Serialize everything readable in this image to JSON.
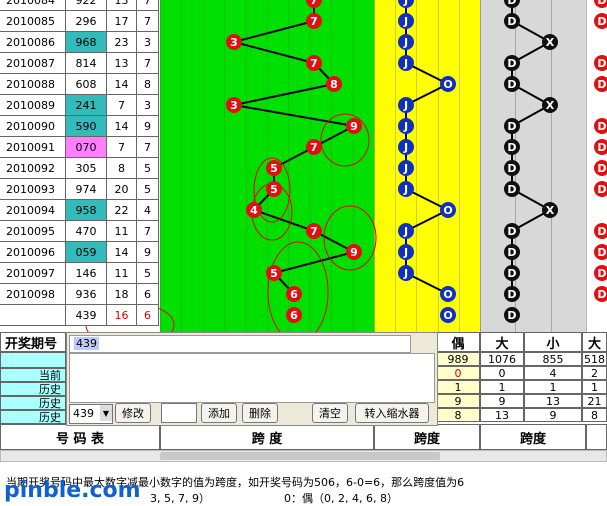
{
  "rows": [
    {
      "period": "2010084",
      "number": "922",
      "sum": "13",
      "span": "7",
      "num_bg": "#ffffff",
      "red": "7",
      "blue": "J",
      "dark": "D"
    },
    {
      "period": "2010085",
      "number": "296",
      "sum": "17",
      "span": "7",
      "num_bg": "#ffffff",
      "red": "7",
      "blue": "J",
      "dark": "D"
    },
    {
      "period": "2010086",
      "number": "968",
      "sum": "23",
      "span": "3",
      "num_bg": "#33bbbb",
      "red": "3",
      "blue": "J",
      "dark": "X"
    },
    {
      "period": "2010087",
      "number": "814",
      "sum": "13",
      "span": "7",
      "num_bg": "#ffffff",
      "red": "7",
      "blue": "J",
      "dark": "D"
    },
    {
      "period": "2010088",
      "number": "608",
      "sum": "14",
      "span": "8",
      "num_bg": "#ffffff",
      "red": "8",
      "blue": "O",
      "dark": "D"
    },
    {
      "period": "2010089",
      "number": "241",
      "sum": "7",
      "span": "3",
      "num_bg": "#33bbbb",
      "red": "3",
      "blue": "J",
      "dark": "X"
    },
    {
      "period": "2010090",
      "number": "590",
      "sum": "14",
      "span": "9",
      "num_bg": "#33bbbb",
      "red": "9",
      "blue": "J",
      "dark": "D"
    },
    {
      "period": "2010091",
      "number": "070",
      "sum": "7",
      "span": "7",
      "num_bg": "#ff80ff",
      "red": "7",
      "blue": "J",
      "dark": "D"
    },
    {
      "period": "2010092",
      "number": "305",
      "sum": "8",
      "span": "5",
      "num_bg": "#ffffff",
      "red": "5",
      "blue": "J",
      "dark": "D"
    },
    {
      "period": "2010093",
      "number": "974",
      "sum": "20",
      "span": "5",
      "num_bg": "#ffffff",
      "red": "5",
      "blue": "J",
      "dark": "D"
    },
    {
      "period": "2010094",
      "number": "958",
      "sum": "22",
      "span": "4",
      "num_bg": "#33bbbb",
      "red": "4",
      "blue": "O",
      "dark": "X"
    },
    {
      "period": "2010095",
      "number": "470",
      "sum": "11",
      "span": "7",
      "num_bg": "#ffffff",
      "red": "7",
      "blue": "J",
      "dark": "D"
    },
    {
      "period": "2010096",
      "number": "059",
      "sum": "14",
      "span": "9",
      "num_bg": "#33bbbb",
      "red": "9",
      "blue": "J",
      "dark": "D"
    },
    {
      "period": "2010097",
      "number": "146",
      "sum": "11",
      "span": "5",
      "num_bg": "#ffffff",
      "red": "5",
      "blue": "J",
      "dark": "D"
    },
    {
      "period": "2010098",
      "number": "936",
      "sum": "18",
      "span": "6",
      "num_bg": "#ffffff",
      "red": "6",
      "blue": "O",
      "dark": "D"
    }
  ],
  "pred_row": {
    "number": "439",
    "sum": "16",
    "span": "6",
    "red": "6",
    "blue": "O",
    "dark": "D"
  },
  "left_stats": {
    "label_period": "开奖期号",
    "label_current": "当前",
    "label_hist1": "历史",
    "label_hist2": "历史",
    "label_hist3": "历史"
  },
  "right_header": {
    "even": "偶",
    "big": "大",
    "small": "小",
    "big2": "大"
  },
  "stat_values": [
    {
      "even": "989",
      "big": "1076",
      "small": "855",
      "far": "518"
    },
    {
      "even": "0",
      "big": "0",
      "small": "4",
      "far": "2"
    },
    {
      "even": "1",
      "big": "1",
      "small": "1",
      "far": "1"
    },
    {
      "even": "9",
      "big": "9",
      "small": "13",
      "far": "21"
    },
    {
      "even": "8",
      "big": "13",
      "small": "9",
      "far": "8"
    }
  ],
  "panel": {
    "input_value": "439",
    "select_value": "439",
    "btn_modify": "修改",
    "btn_add": "添加",
    "btn_delete": "删除",
    "btn_clear": "清空",
    "btn_transfer": "转入缩水器"
  },
  "bottom_headers": {
    "code_table": "号 码 表",
    "span1": "跨 度",
    "span2": "跨度",
    "span3": "跨度"
  },
  "footer": {
    "line1": "当期开奖号码中最大数字减最小数字的值为跨度，如开奖号码为506，6-0=6，那么跨度值为6",
    "line2_left": "3, 5, 7, 9）",
    "line2_right": "0：偶（0, 2, 4, 6, 8）",
    "watermark": "pinble.com"
  }
}
